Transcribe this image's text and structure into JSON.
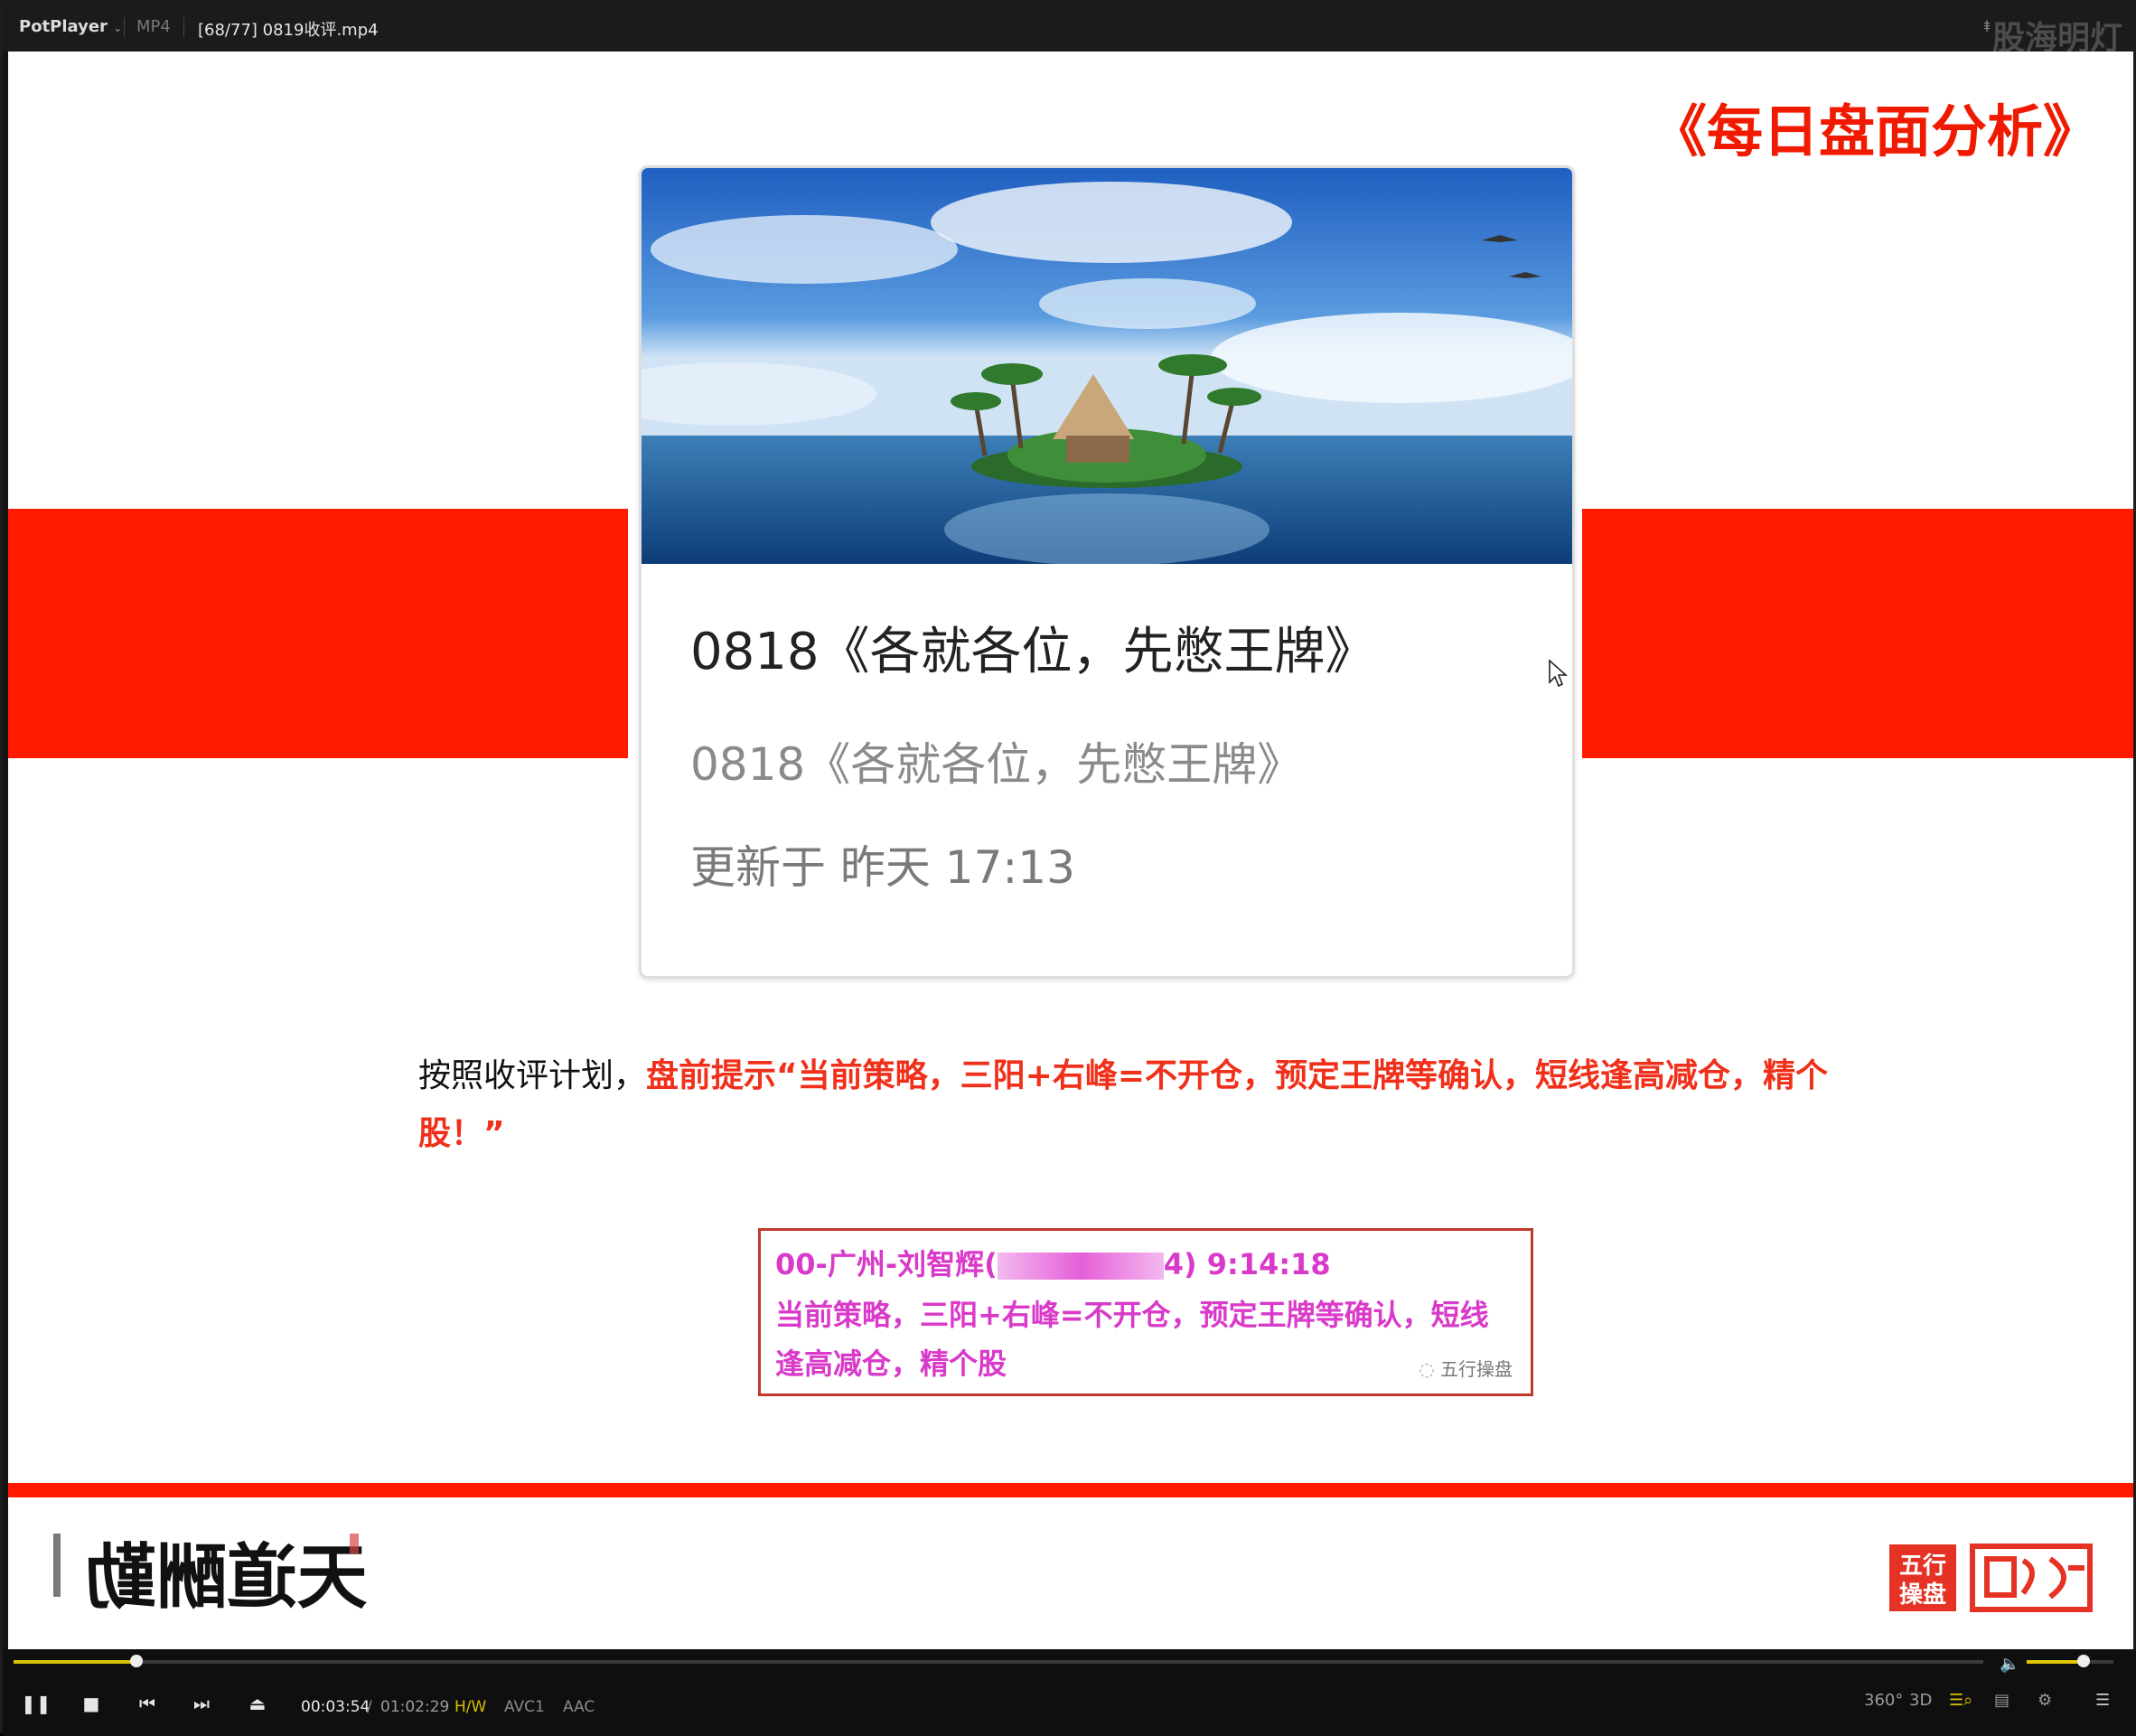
{
  "titlebar": {
    "app": "PotPlayer",
    "format": "MP4",
    "file": "[68/77] 0819收评.mp4",
    "watermark": "股海明灯"
  },
  "slide": {
    "title": "《每日盘面分析》",
    "card": {
      "image": "tropical-island-photo",
      "title": "0818《各就各位，先憋王牌》",
      "subtitle": "0818《各就各位，先憋王牌》",
      "updated": "更新于 昨天 17:13"
    },
    "plan": {
      "prefix": "按照收评计划，",
      "highlight": "盘前提示“当前策略，三阳+右峰=不开仓，预定王牌等确认，短线逢高减仓，精个股！”"
    },
    "quote": {
      "line1_pre": "00-广州-刘智辉(",
      "line1_post": "4)  9:14:18",
      "line2": "当前策略，三阳+右峰=不开仓，预定王牌等确认，短线",
      "line3": "逢高减仓，精个股",
      "source": "五行操盘"
    },
    "calligraphy": "天道酬勤",
    "seal": [
      "五行",
      "操盘"
    ],
    "colors": {
      "accent_red": "#ff1a00",
      "quote_pink": "#d93ac9"
    }
  },
  "player": {
    "current_time": "00:03:54",
    "separator": "/",
    "total_time": "01:02:29",
    "badges": [
      "H/W",
      "AVC1",
      "AAC"
    ],
    "progress": 0.0625,
    "volume": 0.66,
    "right_buttons": [
      "360°",
      "3D"
    ]
  }
}
